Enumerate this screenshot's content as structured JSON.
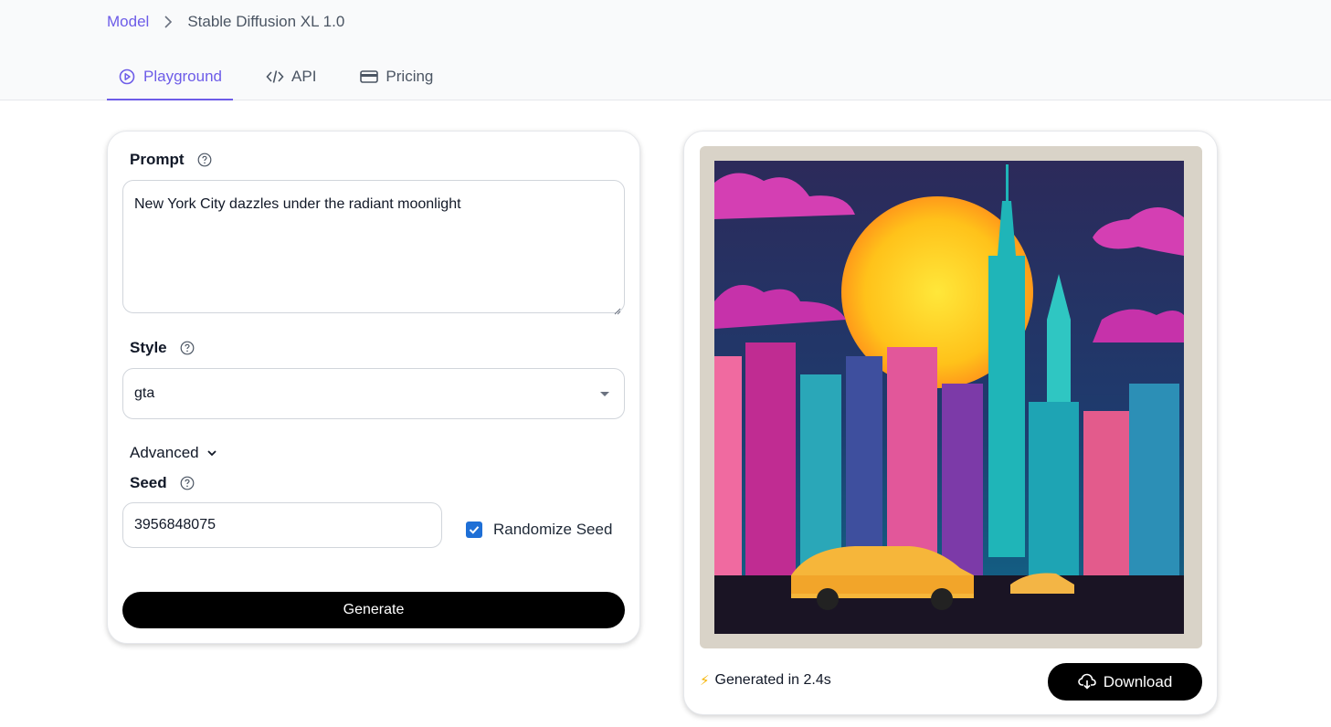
{
  "breadcrumb": {
    "parent": "Model",
    "current": "Stable Diffusion XL 1.0"
  },
  "tabs": [
    {
      "label": "Playground",
      "icon": "play-circle-icon",
      "active": true
    },
    {
      "label": "API",
      "icon": "code-icon",
      "active": false
    },
    {
      "label": "Pricing",
      "icon": "credit-card-icon",
      "active": false
    }
  ],
  "form": {
    "prompt_label": "Prompt",
    "prompt_value": "New York City dazzles under the radiant moonlight",
    "style_label": "Style",
    "style_value": "gta",
    "advanced_label": "Advanced",
    "seed_label": "Seed",
    "seed_value": "3956848075",
    "randomize_label": "Randomize Seed",
    "randomize_checked": true,
    "generate_label": "Generate"
  },
  "output": {
    "status_text": "Generated in 2.4s",
    "download_label": "Download"
  },
  "colors": {
    "accent": "#6d5ce8",
    "checkbox": "#1e6fd6",
    "button": "#000000"
  }
}
